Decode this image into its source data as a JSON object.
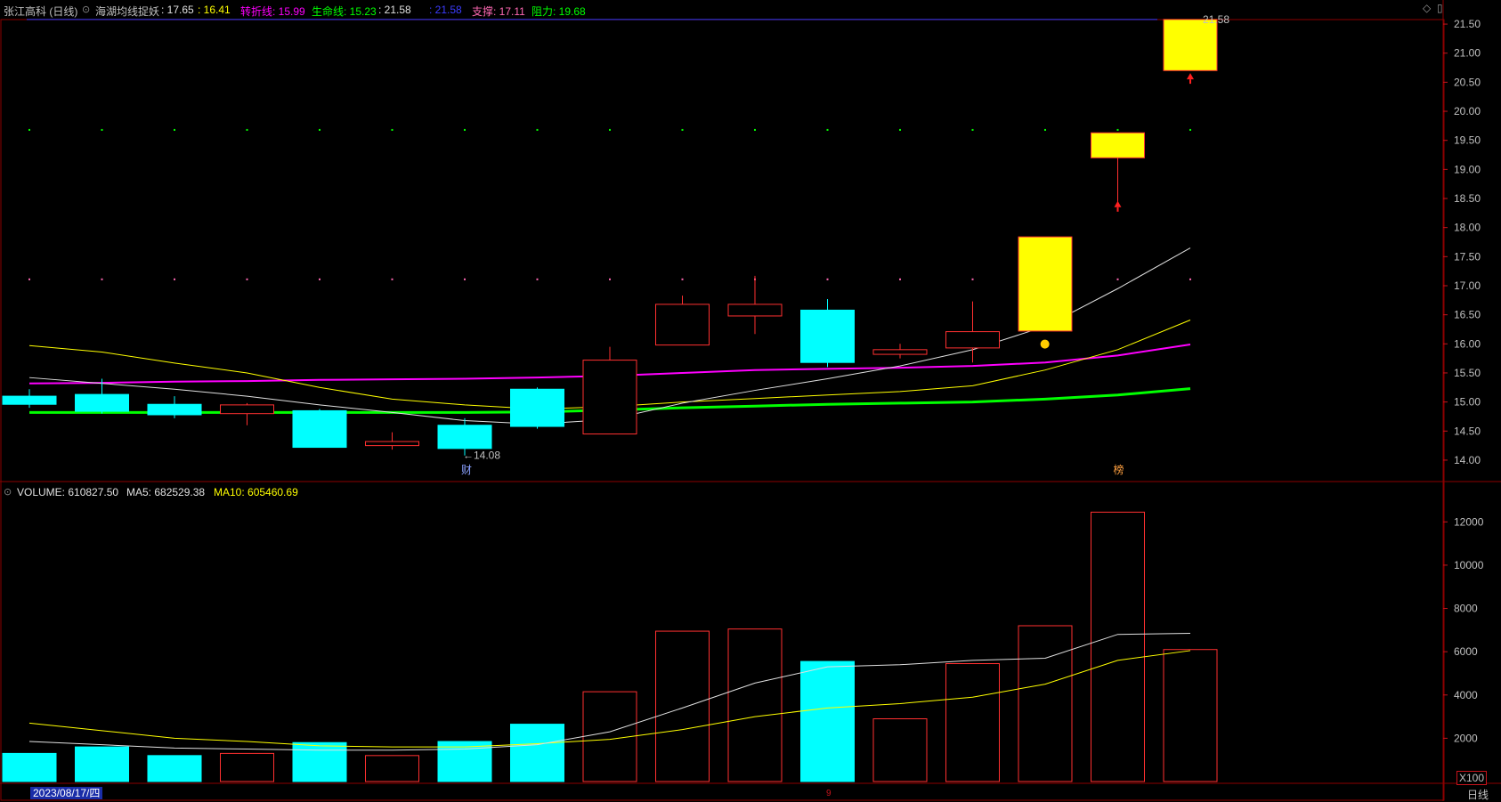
{
  "header": {
    "stock_name": "张江高科 (日线)",
    "indicator_name": "海湖均线捉妖",
    "v1": ": 17.65",
    "v2": ": 16.41",
    "turn_label": "转折线: 15.99",
    "life_label": "生命线: 15.23",
    "v3": ": 21.58",
    "v4": ": 21.58",
    "support_label": "支撑: 17.11",
    "resist_label": "阻力: 19.68",
    "colors": {
      "white": "#e0e0e0",
      "yellow": "#ffff00",
      "magenta": "#ff00ff",
      "green": "#00ff00",
      "blue": "#3c3cff",
      "pink": "#ff69b4"
    }
  },
  "volume_header": {
    "label": "VOLUME: 610827.50",
    "ma5": "MA5: 682529.38",
    "ma10": "MA10: 605460.69"
  },
  "price_axis_ticks": [
    "21.50",
    "21.00",
    "20.50",
    "20.00",
    "19.50",
    "19.00",
    "18.50",
    "18.00",
    "17.50",
    "17.00",
    "16.50",
    "16.00",
    "15.50",
    "15.00",
    "14.50",
    "14.00"
  ],
  "volume_axis_ticks": [
    "12000",
    "10000",
    "8000",
    "6000",
    "4000",
    "2000"
  ],
  "annotations": {
    "high_label": "21.58",
    "low_label": "←14.08",
    "cai_mark": "财",
    "bang_mark": "榜"
  },
  "footer": {
    "date": "2023/08/17/四",
    "scale": "X100",
    "period": "日线",
    "month_marker": "9"
  },
  "chart_data": {
    "type": "candlestick",
    "candles": [
      {
        "o": 15.1,
        "c": 14.96,
        "h": 15.22,
        "l": 14.9,
        "v": 1300
      },
      {
        "o": 15.13,
        "c": 14.84,
        "h": 15.4,
        "l": 14.8,
        "v": 1600
      },
      {
        "o": 14.96,
        "c": 14.78,
        "h": 15.1,
        "l": 14.72,
        "v": 1200
      },
      {
        "o": 14.8,
        "c": 14.95,
        "h": 14.98,
        "l": 14.6,
        "v": 1300
      },
      {
        "o": 14.85,
        "c": 14.22,
        "h": 14.88,
        "l": 14.22,
        "v": 1800
      },
      {
        "o": 14.25,
        "c": 14.32,
        "h": 14.48,
        "l": 14.18,
        "v": 1200
      },
      {
        "o": 14.6,
        "c": 14.2,
        "h": 14.72,
        "l": 14.08,
        "v": 1850
      },
      {
        "o": 15.22,
        "c": 14.58,
        "h": 15.25,
        "l": 14.54,
        "v": 2650
      },
      {
        "o": 14.45,
        "c": 15.72,
        "h": 15.95,
        "l": 14.45,
        "v": 4150
      },
      {
        "o": 15.98,
        "c": 16.68,
        "h": 16.83,
        "l": 15.98,
        "v": 6950
      },
      {
        "o": 16.48,
        "c": 16.68,
        "h": 17.17,
        "l": 16.17,
        "v": 7050
      },
      {
        "o": 16.58,
        "c": 15.68,
        "h": 16.77,
        "l": 15.6,
        "v": 5550
      },
      {
        "o": 15.82,
        "c": 15.9,
        "h": 16.0,
        "l": 15.75,
        "v": 2900
      },
      {
        "o": 15.93,
        "c": 16.21,
        "h": 16.73,
        "l": 15.68,
        "v": 5450
      },
      {
        "o": 16.22,
        "c": 17.84,
        "h": 17.84,
        "l": 16.22,
        "v": 7200
      },
      {
        "o": 19.2,
        "c": 19.63,
        "h": 19.63,
        "l": 18.38,
        "v": 12450
      },
      {
        "o": 20.7,
        "c": 21.58,
        "h": 21.58,
        "l": 20.7,
        "v": 6100
      }
    ],
    "ma_white": [
      15.42,
      15.32,
      15.22,
      15.1,
      14.95,
      14.82,
      14.68,
      14.62,
      14.7,
      14.98,
      15.2,
      15.4,
      15.62,
      15.9,
      16.3,
      16.95,
      17.65
    ],
    "ma_yellow": [
      15.97,
      15.86,
      15.67,
      15.5,
      15.25,
      15.05,
      14.95,
      14.88,
      14.92,
      15.0,
      15.06,
      15.12,
      15.18,
      15.28,
      15.55,
      15.9,
      16.41
    ],
    "turn_line": [
      15.32,
      15.33,
      15.35,
      15.36,
      15.38,
      15.39,
      15.4,
      15.42,
      15.45,
      15.5,
      15.55,
      15.57,
      15.59,
      15.62,
      15.68,
      15.8,
      15.99
    ],
    "life_line": [
      14.82,
      14.82,
      14.82,
      14.82,
      14.82,
      14.82,
      14.82,
      14.83,
      14.86,
      14.9,
      14.93,
      14.96,
      14.98,
      15.0,
      15.05,
      15.12,
      15.23
    ],
    "support": 17.11,
    "resist": 19.68,
    "vol_ma5": [
      1850,
      1700,
      1550,
      1500,
      1450,
      1450,
      1500,
      1700,
      2300,
      3400,
      4550,
      5300,
      5400,
      5600,
      5700,
      6800,
      6850
    ],
    "vol_ma10": [
      2700,
      2350,
      2000,
      1850,
      1650,
      1600,
      1600,
      1750,
      1950,
      2400,
      3000,
      3400,
      3600,
      3900,
      4500,
      5600,
      6050
    ],
    "price_range": [
      13.8,
      21.7
    ],
    "volume_range": [
      0,
      13000
    ]
  }
}
